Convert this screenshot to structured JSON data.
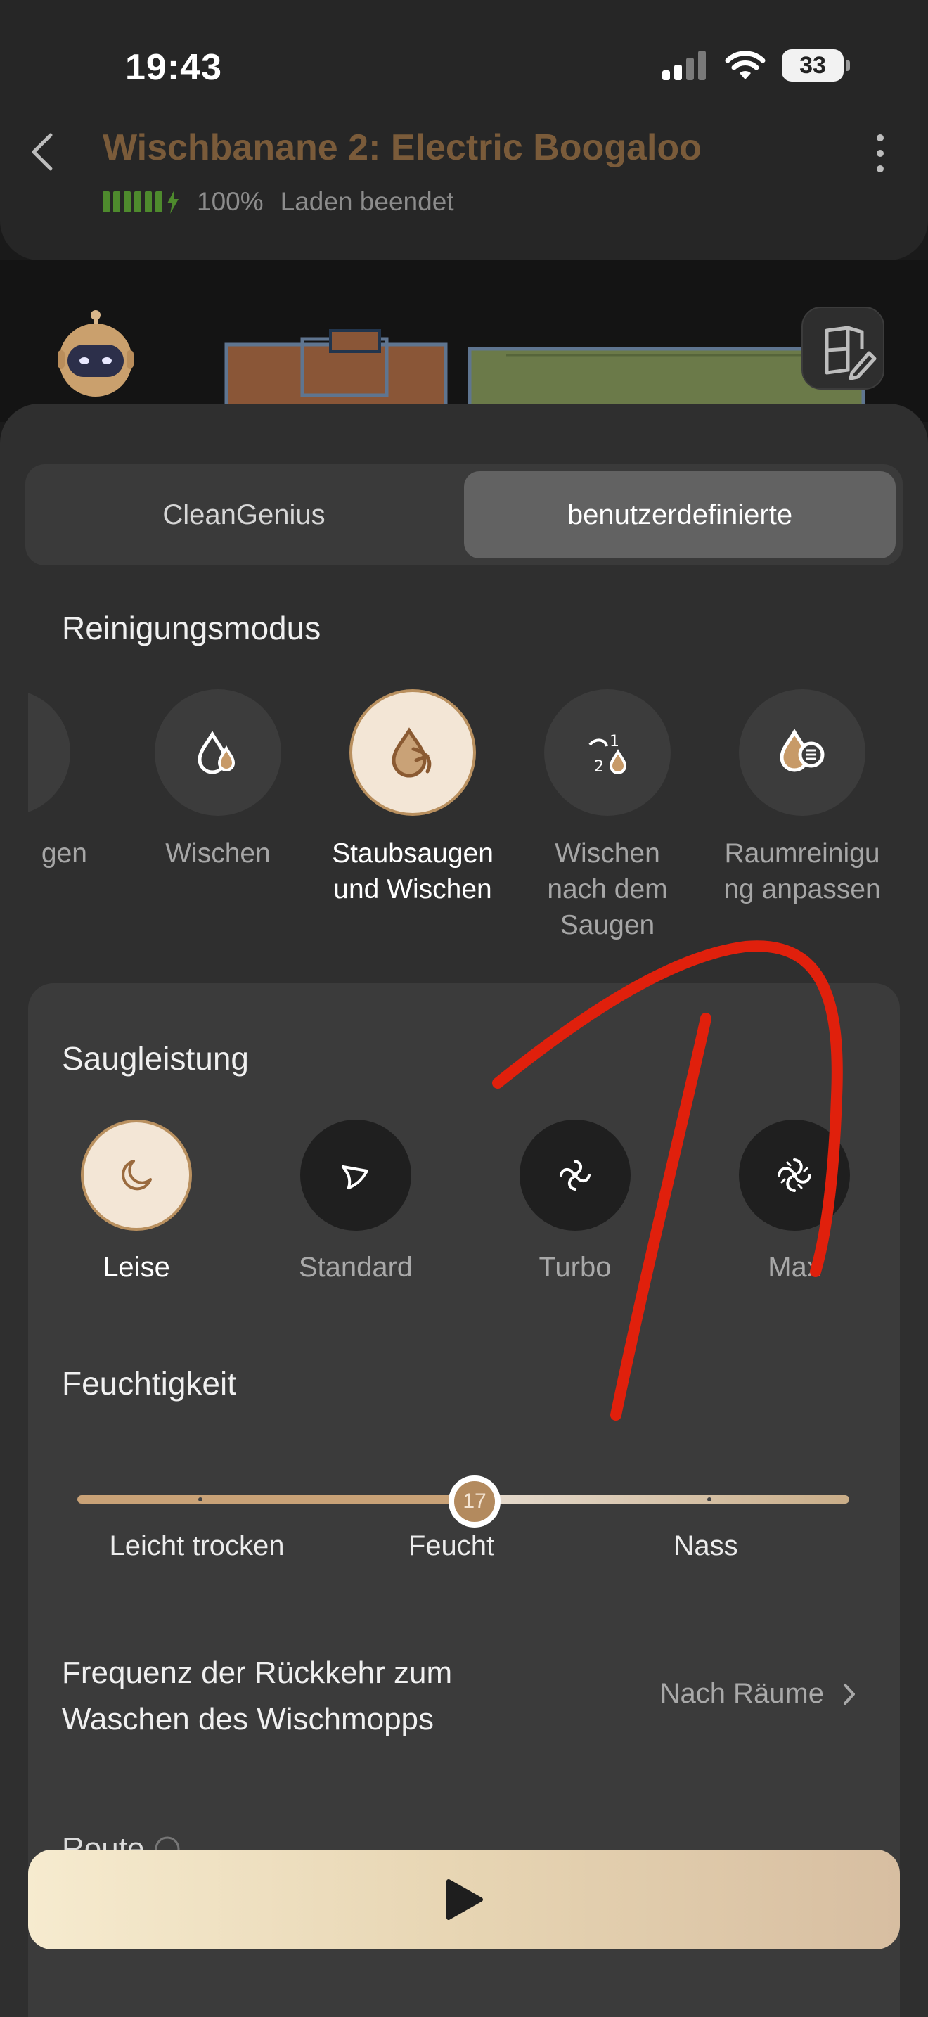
{
  "status_bar": {
    "time": "19:43",
    "battery": "33"
  },
  "header": {
    "title": "Wischbanane 2: Electric Boogaloo",
    "battery_percent": "100%",
    "battery_status": "Laden beendet"
  },
  "segmented": {
    "left": "CleanGenius",
    "right": "benutzerdefinierte"
  },
  "cleaning_mode": {
    "title": "Reinigungsmodus",
    "items": [
      {
        "label": "gen",
        "selected": false
      },
      {
        "label": "Wischen",
        "selected": false
      },
      {
        "label": "Staubsaugen\nund Wischen",
        "selected": true
      },
      {
        "label": "Wischen\nnach dem\nSaugen",
        "selected": false
      },
      {
        "label": "Raumreinigu\nng anpassen",
        "selected": false
      }
    ]
  },
  "suction": {
    "title": "Saugleistung",
    "items": [
      {
        "label": "Leise",
        "selected": true
      },
      {
        "label": "Standard",
        "selected": false
      },
      {
        "label": "Turbo",
        "selected": false
      },
      {
        "label": "Max",
        "selected": false
      }
    ]
  },
  "moisture": {
    "title": "Feuchtigkeit",
    "value": "17",
    "level_fraction": 0.5,
    "labels": [
      "Leicht trocken",
      "Feucht",
      "Nass"
    ]
  },
  "frequency": {
    "label_line1": "Frequenz der Rückkehr zum",
    "label_line2": "Waschen des Wischmopps",
    "value": "Nach Räume"
  },
  "route": {
    "label": "Route"
  },
  "colors": {
    "accent": "#b38a5e",
    "title_brown": "#7a5b3a",
    "battery_green": "#4e8a2d",
    "annotation_red": "#e0200c"
  }
}
